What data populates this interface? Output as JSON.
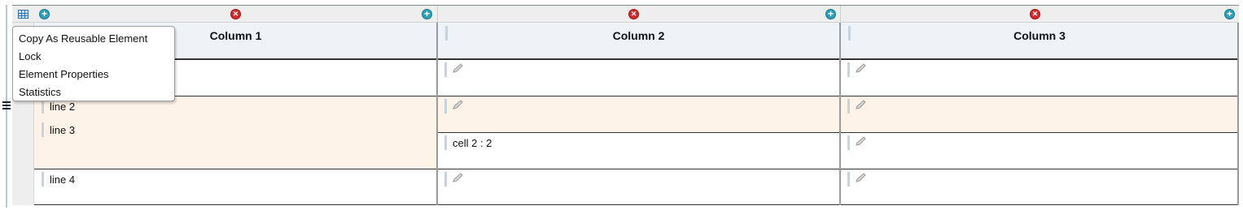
{
  "table": {
    "columns": [
      {
        "header": "Column 1"
      },
      {
        "header": "Column 2"
      },
      {
        "header": "Column 3"
      }
    ],
    "cells": {
      "col1_row2": "line 2",
      "col1_row3": "line 3",
      "col1_row4": "line 4",
      "col2_row3": "cell 2 : 2"
    }
  },
  "context_menu": {
    "items": [
      {
        "label": "Copy As Reusable Element"
      },
      {
        "label": "Lock"
      },
      {
        "label": "Element Properties"
      },
      {
        "label": "Statistics"
      }
    ]
  },
  "icons": {
    "table": "table-icon",
    "add_column": "plus-circle-icon",
    "delete_column": "x-circle-icon",
    "edit": "pencil-icon",
    "row_menu": "hamburger-icon"
  },
  "colors": {
    "add": "#2aa1b8",
    "delete": "#d62828",
    "row_highlight": "#fdf3e6",
    "header_bg": "#eef3f7"
  }
}
